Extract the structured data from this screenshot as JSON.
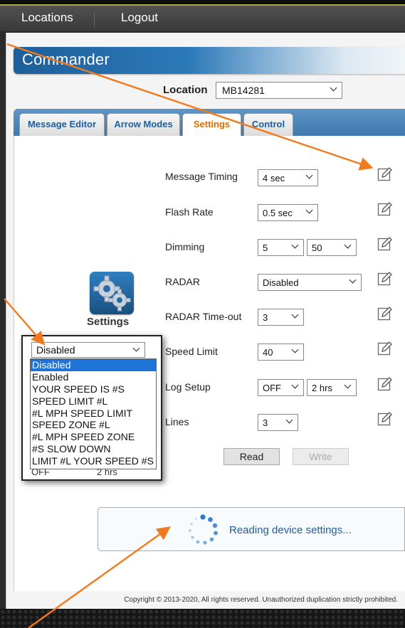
{
  "topnav": {
    "locations": "Locations",
    "logout": "Logout"
  },
  "app": {
    "title": "Commander"
  },
  "location": {
    "label": "Location",
    "value": "MB14281"
  },
  "tabs": [
    {
      "label": "Message Editor"
    },
    {
      "label": "Arrow Modes"
    },
    {
      "label": "Settings"
    },
    {
      "label": "Control"
    }
  ],
  "settings": {
    "caption": "Settings",
    "rows": [
      {
        "label": "Message Timing",
        "value": "4 sec"
      },
      {
        "label": "Flash Rate",
        "value": "0.5 sec"
      },
      {
        "label": "Dimming",
        "value": "5",
        "value2": "50"
      },
      {
        "label": "RADAR",
        "value": "Disabled"
      },
      {
        "label": "RADAR Time-out",
        "value": "3"
      },
      {
        "label": "Speed Limit",
        "value": "40"
      },
      {
        "label": "Log Setup",
        "value": "OFF",
        "value2": "2 hrs"
      },
      {
        "label": "Lines",
        "value": "3"
      }
    ]
  },
  "radar_popup": {
    "selected": "Disabled",
    "options": [
      "Disabled",
      "Enabled",
      "YOUR SPEED IS #S",
      "SPEED LIMIT #L",
      "#L MPH SPEED LIMIT",
      "SPEED ZONE #L",
      "#L MPH SPEED ZONE",
      "#S SLOW DOWN",
      "LIMIT #L YOUR SPEED #S"
    ],
    "behind_left": "OFF",
    "behind_right": "2 hrs"
  },
  "buttons": {
    "read": "Read",
    "write": "Write"
  },
  "status": {
    "text": "Reading device settings..."
  },
  "footer": {
    "copyright": "Copyright © 2013-2020, All rights reserved. Unauthorized duplication strictly prohibited."
  },
  "colors": {
    "accent": "#e06b00",
    "brand": "#1d5f9a",
    "annotation_arrow": "#f07a1e"
  }
}
